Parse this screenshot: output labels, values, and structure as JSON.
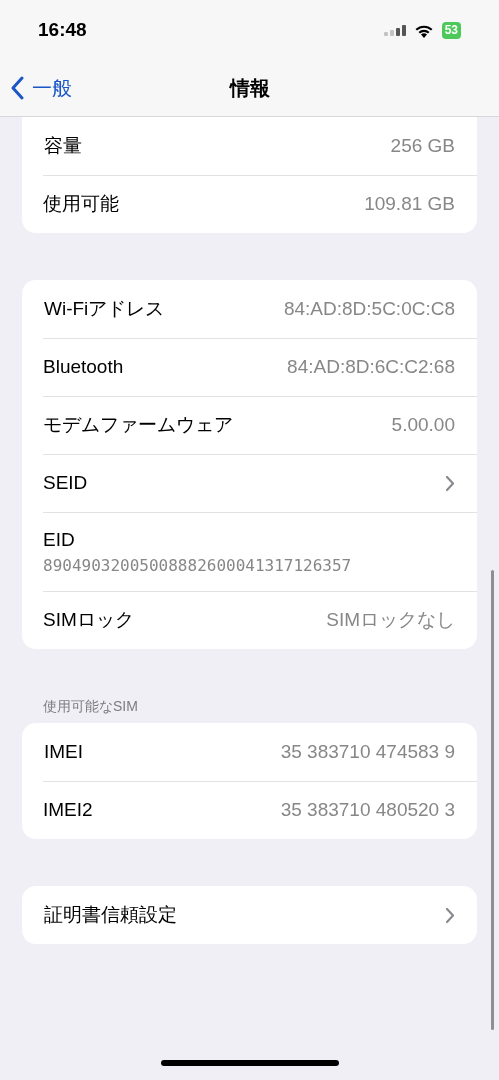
{
  "status_bar": {
    "time": "16:48",
    "battery": "53"
  },
  "nav": {
    "back": "一般",
    "title": "情報"
  },
  "groups": [
    {
      "rows": [
        {
          "kind": "value",
          "label": "容量",
          "value": "256 GB"
        },
        {
          "kind": "value",
          "label": "使用可能",
          "value": "109.81 GB"
        }
      ]
    },
    {
      "rows": [
        {
          "kind": "value",
          "label": "Wi-Fiアドレス",
          "value": "84:AD:8D:5C:0C:C8"
        },
        {
          "kind": "value",
          "label": "Bluetooth",
          "value": "84:AD:8D:6C:C2:68"
        },
        {
          "kind": "value",
          "label": "モデムファームウェア",
          "value": "5.00.00"
        },
        {
          "kind": "chevron",
          "label": "SEID"
        },
        {
          "kind": "stacked",
          "label": "EID",
          "value": "89049032005008882600041317126357"
        },
        {
          "kind": "value",
          "label": "SIMロック",
          "value": "SIMロックなし"
        }
      ]
    },
    {
      "header": "使用可能なSIM",
      "rows": [
        {
          "kind": "value",
          "label": "IMEI",
          "value": "35 383710 474583 9"
        },
        {
          "kind": "value",
          "label": "IMEI2",
          "value": "35 383710 480520 3"
        }
      ]
    },
    {
      "rows": [
        {
          "kind": "chevron",
          "label": "証明書信頼設定"
        }
      ]
    }
  ]
}
